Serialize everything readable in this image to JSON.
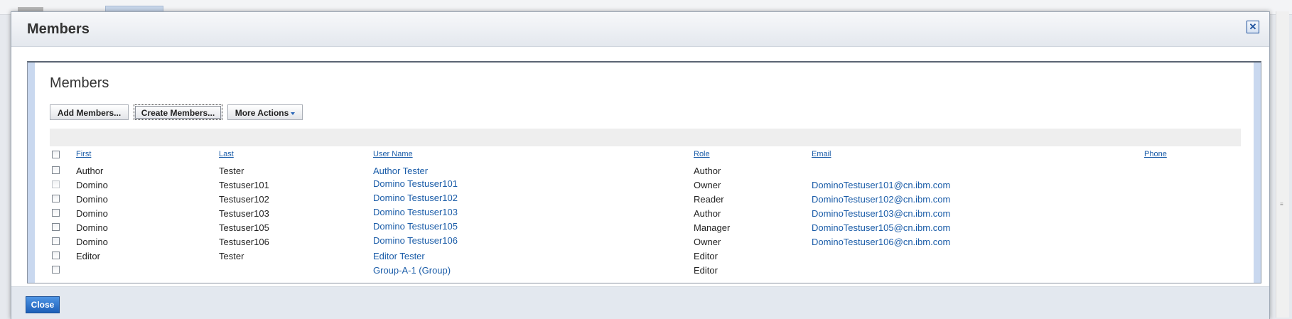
{
  "dialog": {
    "title": "Members",
    "close_x": "✕",
    "close_button": "Close"
  },
  "panel": {
    "title": "Members",
    "buttons": {
      "add": "Add Members...",
      "create": "Create Members...",
      "more": "More Actions"
    }
  },
  "table": {
    "headers": {
      "first": "First",
      "last": "Last",
      "username": "User Name",
      "role": "Role",
      "email": "Email",
      "phone": "Phone"
    },
    "rows": [
      {
        "first": "Author",
        "last": "Tester",
        "username": "Author Tester",
        "role": "Author",
        "email": ""
      },
      {
        "first": "Domino",
        "last": "Testuser101",
        "username": "Domino Testuser101",
        "role": "Owner",
        "email": "DominoTestuser101@cn.ibm.com"
      },
      {
        "first": "Domino",
        "last": "Testuser102",
        "username": "Domino Testuser102",
        "role": "Reader",
        "email": "DominoTestuser102@cn.ibm.com"
      },
      {
        "first": "Domino",
        "last": "Testuser103",
        "username": "Domino Testuser103",
        "role": "Author",
        "email": "DominoTestuser103@cn.ibm.com"
      },
      {
        "first": "Domino",
        "last": "Testuser105",
        "username": "Domino Testuser105",
        "role": "Manager",
        "email": "DominoTestuser105@cn.ibm.com"
      },
      {
        "first": "Domino",
        "last": "Testuser106",
        "username": "Domino Testuser106",
        "role": "Owner",
        "email": "DominoTestuser106@cn.ibm.com"
      },
      {
        "first": "Editor",
        "last": "Tester",
        "username": "Editor Tester",
        "role": "Editor",
        "email": ""
      },
      {
        "first": "",
        "last": "",
        "username": "Group-A-1 (Group)",
        "role": "Editor",
        "email": ""
      }
    ]
  },
  "colors": {
    "link": "#1a5ca8",
    "primary_button": "#2a6fc9",
    "frame_accent": "#c9d8ef"
  }
}
